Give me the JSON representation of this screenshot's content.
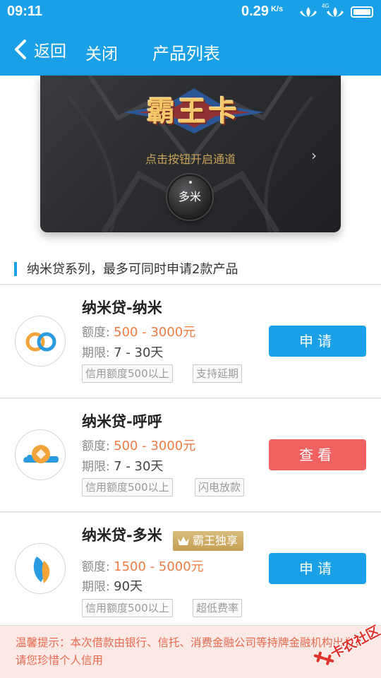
{
  "status_bar": {
    "time": "09:11",
    "speed_value": "0.29",
    "speed_unit": "K/s",
    "network": "4G"
  },
  "nav": {
    "back_label": "返回",
    "close_label": "关闭",
    "title": "产品列表"
  },
  "banner": {
    "logo_text": "霸王卡",
    "hint": "点击按钮开启通道",
    "button_label": "多米"
  },
  "series": {
    "text": "纳米贷系列，最多可同时申请2款产品"
  },
  "products": [
    {
      "name": "纳米贷-纳米",
      "amount_label": "额度:",
      "amount_value": "500 - 3000元",
      "term_label": "期限:",
      "term_value": "7 - 30天",
      "tags": [
        "信用额度500以上",
        "支持延期"
      ],
      "action_label": "申请",
      "action_color": "#1aa0e6",
      "icon": "link-rings-icon"
    },
    {
      "name": "纳米贷-呼呼",
      "amount_label": "额度:",
      "amount_value": "500 - 3000元",
      "term_label": "期限:",
      "term_value": "7 - 30天",
      "tags": [
        "信用额度500以上",
        "闪电放款"
      ],
      "action_label": "查看",
      "action_color": "#f06262",
      "icon": "coin-cloud-icon"
    },
    {
      "name": "纳米贷-多米",
      "badge": "霸王独享",
      "amount_label": "额度:",
      "amount_value": "1500 - 5000元",
      "term_label": "期限:",
      "term_value": "90天",
      "tags": [
        "信用额度500以上",
        "超低费率"
      ],
      "action_label": "申请",
      "action_color": "#1aa0e6",
      "icon": "leaf-petals-icon"
    }
  ],
  "footer": {
    "text": "温馨提示：本次借款由银行、信托、消费金融公司等持牌金融机构出借，请您珍惜个人信用"
  },
  "watermark": {
    "text": "卡农社区"
  },
  "colors": {
    "primary": "#1aa0e6",
    "amount": "#ef7c44",
    "view_button": "#f06262",
    "badge_gold": "#c9a55c",
    "footer_bg": "#fbe9e6",
    "footer_text": "#e96a4f"
  }
}
